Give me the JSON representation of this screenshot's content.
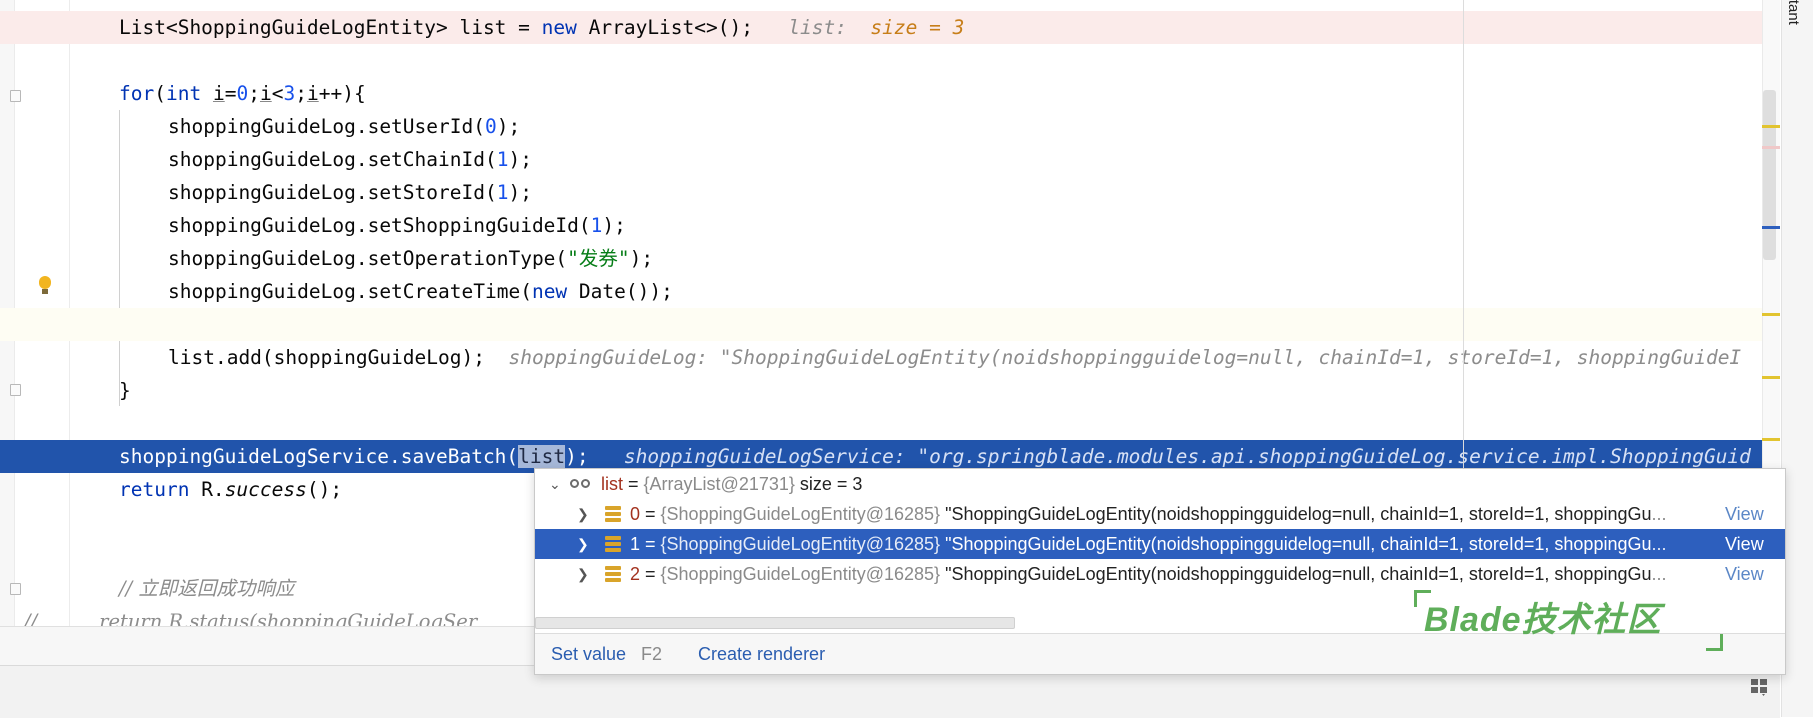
{
  "editor": {
    "side_panel_label": "Assistant",
    "lines": {
      "l1": {
        "t1": "List<ShoppingGuideLogEntity> list = ",
        "kw": "new",
        "t2": " ArrayList<>();",
        "inline_name": "list:",
        "inline_value": "size = 3"
      },
      "l3": {
        "kw1": "for",
        "p1": "(",
        "kw2": "int",
        "sp": " ",
        "v1": "i",
        "eq": "=",
        "n0": "0",
        "semi1": ";",
        "v2": "i",
        "lt": "<",
        "n3": "3",
        "semi2": ";",
        "v3": "i",
        "inc": "++){"
      },
      "l4": {
        "t": "shoppingGuideLog.setUserId(",
        "n": "0",
        "e": ");"
      },
      "l5": {
        "t": "shoppingGuideLog.setChainId(",
        "n": "1",
        "e": ");"
      },
      "l6": {
        "t": "shoppingGuideLog.setStoreId(",
        "n": "1",
        "e": ");"
      },
      "l7": {
        "t": "shoppingGuideLog.setShoppingGuideId(",
        "n": "1",
        "e": ");"
      },
      "l8": {
        "t": "shoppingGuideLog.setOperationType(",
        "s": "\"发券\"",
        "e": ");"
      },
      "l9": {
        "t": "shoppingGuideLog.setCreateTime(",
        "kw": "new",
        "e": " Date());"
      },
      "l11": {
        "t": "list.add(shoppingGuideLog);",
        "inline": "shoppingGuideLog: \"ShoppingGuideLogEntity(noidshoppingguidelog=null, chainId=1, storeId=1, shoppingGuideI"
      },
      "l12": {
        "t": "}"
      },
      "l14": {
        "t1": "shoppingGuideLogService.saveBatch(",
        "sel": "list",
        "t2": ");",
        "inline": "shoppingGuideLogService: \"org.springblade.modules.api.shoppingGuideLog.service.impl.ShoppingGuid"
      },
      "l15": {
        "kw": "return",
        "t1": " R.",
        "it": "success",
        "t2": "();"
      },
      "l18": {
        "cmt": "// 立即返回成功响应"
      },
      "l19": {
        "t": "//          return R.status(shoppingGuideLogSer"
      }
    }
  },
  "popup": {
    "root": {
      "name": "list",
      "eq": " = ",
      "ref": "{ArrayList@21731}",
      "size": "size = 3"
    },
    "items": [
      {
        "index": "0",
        "eq": " = ",
        "ref": "{ShoppingGuideLogEntity@16285}",
        "value": "\"ShoppingGuideLogEntity(noidshoppingguidelog=null, chainId=1, storeId=1, shoppingGu",
        "more": "...",
        "view": "View"
      },
      {
        "index": "1",
        "eq": " = ",
        "ref": "{ShoppingGuideLogEntity@16285}",
        "value": "\"ShoppingGuideLogEntity(noidshoppingguidelog=null, chainId=1, storeId=1, shoppingGu",
        "more": "...",
        "view": "View"
      },
      {
        "index": "2",
        "eq": " = ",
        "ref": "{ShoppingGuideLogEntity@16285}",
        "value": "\"ShoppingGuideLogEntity(noidshoppingguidelog=null, chainId=1, storeId=1, shoppingGu",
        "more": "...",
        "view": "View"
      }
    ],
    "selected_index": 1,
    "footer": {
      "set_value": "Set value",
      "set_value_key": "F2",
      "create_renderer": "Create renderer"
    }
  },
  "watermark": "Blade技术社区",
  "icons": [
    "lightbulb-icon",
    "fold-icon",
    "watch-glasses-icon",
    "field-icon",
    "expand-arrow-icon",
    "layout-icon"
  ],
  "colors": {
    "exec_line": "#2154ab",
    "keyword": "#0033b3",
    "number": "#1750eb",
    "string": "#067d17",
    "inline_value": "#c77e19",
    "selected_row": "#2d5fbe",
    "watermark": "#5fae5a"
  }
}
